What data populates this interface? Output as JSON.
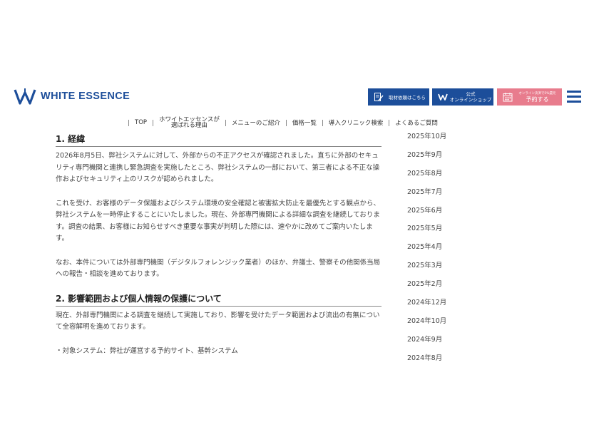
{
  "header": {
    "logo_text": "WHITE ESSENCE",
    "logo_icon": "w-logo-icon",
    "buttons": {
      "interview": "取材依頼はこちら",
      "shop_line1": "公式",
      "shop_line2": "オンラインショップ",
      "reserve_small": "オンライン決済で5%還元",
      "reserve_big": "予約する"
    },
    "menu_icon": "hamburger-menu-icon"
  },
  "nav": {
    "items": [
      {
        "label": "TOP"
      },
      {
        "label_line1": "ホワイトエッセンスが",
        "label_line2": "選ばれる理由"
      },
      {
        "label": "メニューのご紹介"
      },
      {
        "label": "価格一覧"
      },
      {
        "label": "導入クリニック検索"
      },
      {
        "label": "よくあるご質問"
      }
    ]
  },
  "article": {
    "section1": {
      "heading": "1. 経緯",
      "p1": "2026年8月5日、弊社システムに対して、外部からの不正アクセスが確認されました。直ちに外部のセキュリティ専門機関と連携し緊急調査を実施したところ、弊社システムの一部において、第三者による不正な操作およびセキュリティ上のリスクが認められました。",
      "p2": "これを受け、お客様のデータ保護およびシステム環境の安全確認と被害拡大防止を最優先とする観点から、弊社システムを一時停止することにいたしました。現在、外部専門機関による詳細な調査を継続しております。調査の結果、お客様にお知らせすべき重要な事実が判明した際には、速やかに改めてご案内いたします。",
      "p3": "なお、本件については外部専門機関（デジタルフォレンジック業者）のほか、弁護士、警察その他関係当局への報告・相談を進めております。"
    },
    "section2": {
      "heading": "2. 影響範囲および個人情報の保護について",
      "p1": "現在、外部専門機関による調査を継続して実施しており、影響を受けたデータ範囲および流出の有無について全容解明を進めております。",
      "p2": "・対象システム：弊社が運営する予約サイト、基幹システム"
    }
  },
  "archive": [
    "2025年10月",
    "2025年9月",
    "2025年8月",
    "2025年7月",
    "2025年6月",
    "2025年5月",
    "2025年4月",
    "2025年3月",
    "2025年2月",
    "2024年12月",
    "2024年10月",
    "2024年9月",
    "2024年8月"
  ],
  "colors": {
    "brand_blue": "#1c4e9a",
    "reserve_pink": "#e87c8d"
  }
}
